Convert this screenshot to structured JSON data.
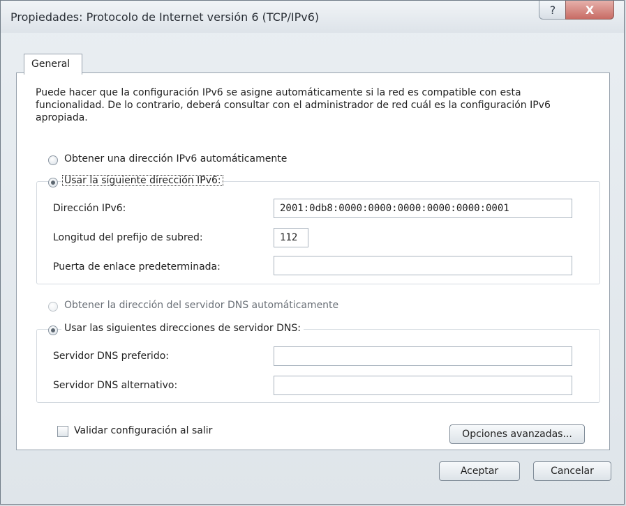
{
  "window": {
    "title": "Propiedades: Protocolo de Internet versión 6 (TCP/IPv6)",
    "help_label": "?",
    "close_label": "X"
  },
  "tabs": [
    {
      "label": "General"
    }
  ],
  "description": "Puede hacer que la configuración IPv6 se asigne automáticamente si la red es compatible con esta funcionalidad. De lo contrario, deberá consultar con el administrador de red cuál es la configuración IPv6 apropiada.",
  "ip": {
    "auto_label": "Obtener una dirección IPv6 automáticamente",
    "manual_label": "Usar la siguiente dirección IPv6:",
    "selected": "manual",
    "address_label": "Dirección IPv6:",
    "address_value": "2001:0db8:0000:0000:0000:0000:0000:0001",
    "prefix_label": "Longitud del prefijo de subred:",
    "prefix_value": "112",
    "gateway_label": "Puerta de enlace predeterminada:",
    "gateway_value": ""
  },
  "dns": {
    "auto_label": "Obtener la dirección del servidor DNS automáticamente",
    "manual_label": "Usar las siguientes direcciones de servidor DNS:",
    "selected": "manual",
    "preferred_label": "Servidor DNS preferido:",
    "preferred_value": "",
    "alternate_label": "Servidor DNS alternativo:",
    "alternate_value": ""
  },
  "validate": {
    "label": "Validar configuración al salir",
    "checked": false
  },
  "buttons": {
    "advanced": "Opciones avanzadas...",
    "ok": "Aceptar",
    "cancel": "Cancelar"
  }
}
